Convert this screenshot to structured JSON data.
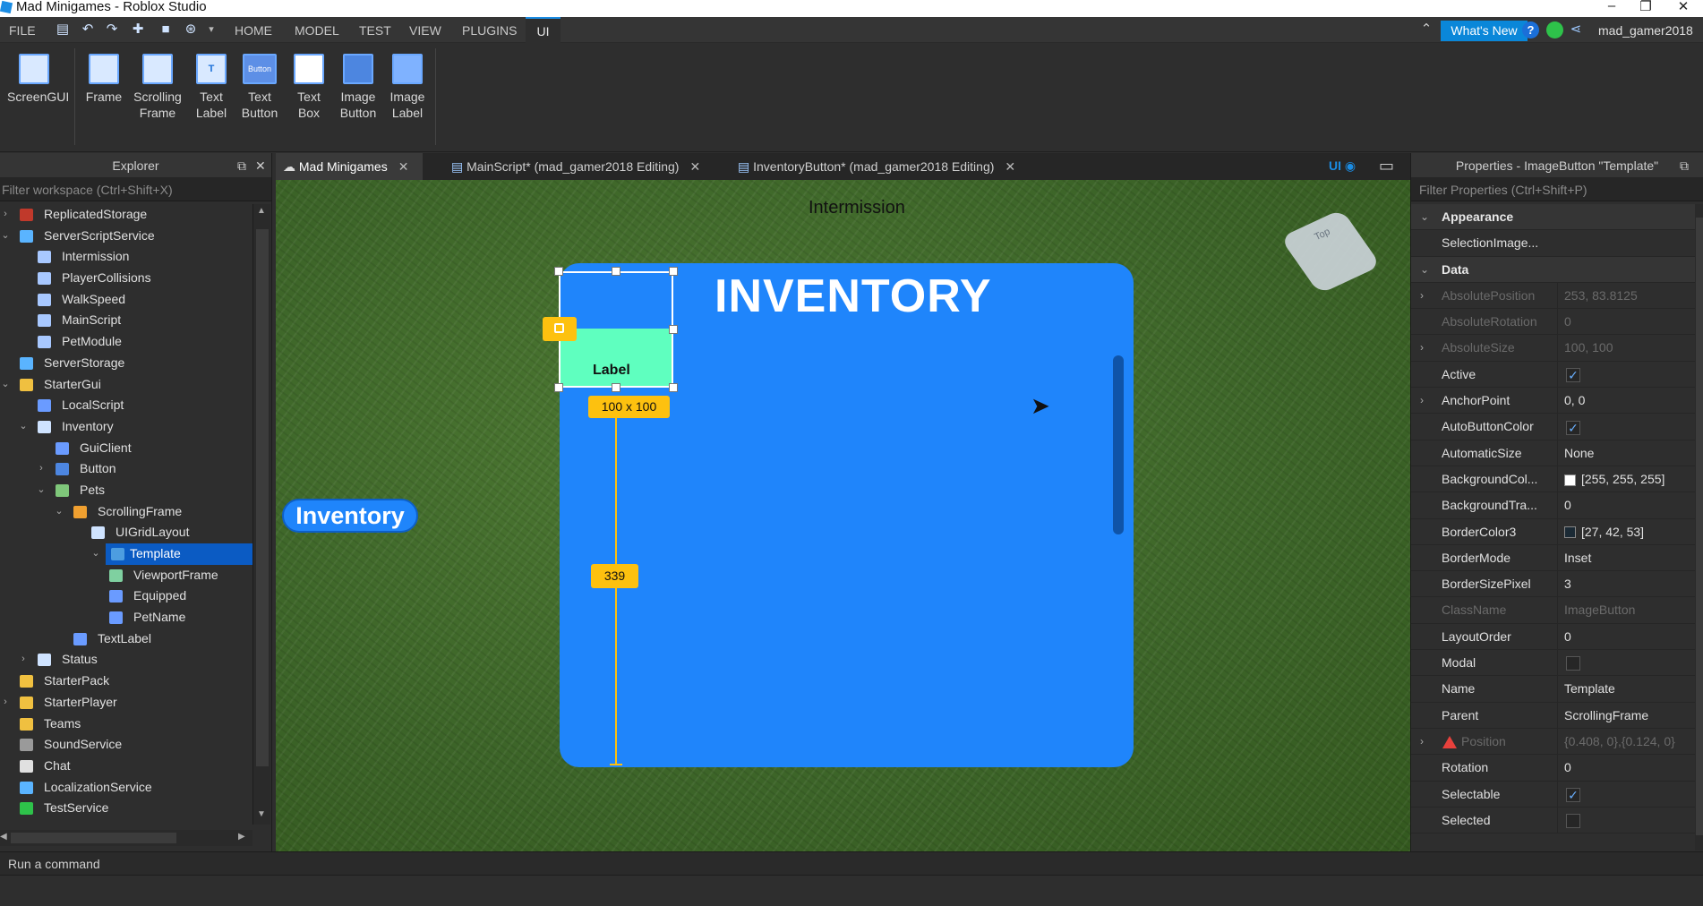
{
  "window": {
    "title": "Mad Minigames - Roblox Studio",
    "minimize": "–",
    "restore": "❐",
    "close": "✕"
  },
  "menu": {
    "file": "FILE",
    "home": "HOME",
    "model": "MODEL",
    "test": "TEST",
    "view": "VIEW",
    "plugins": "PLUGINS",
    "ui": "UI"
  },
  "header": {
    "whats_new": "What's New",
    "username": "mad_gamer2018"
  },
  "ribbon": {
    "screengui": "ScreenGUI",
    "frame": "Frame",
    "scrolling_frame_1": "Scrolling",
    "scrolling_frame_2": "Frame",
    "text_label_1": "Text",
    "text_label_2": "Label",
    "text_button_1": "Text",
    "text_button_2": "Button",
    "text_box_1": "Text",
    "text_box_2": "Box",
    "image_button_1": "Image",
    "image_button_2": "Button",
    "image_label_1": "Image",
    "image_label_2": "Label",
    "button_icon_text": "Button",
    "text_icon": "T"
  },
  "explorer": {
    "title": "Explorer",
    "filter_placeholder": "Filter workspace (Ctrl+Shift+X)",
    "items": [
      {
        "label": "ReplicatedStorage"
      },
      {
        "label": "ServerScriptService"
      },
      {
        "label": "Intermission"
      },
      {
        "label": "PlayerCollisions"
      },
      {
        "label": "WalkSpeed"
      },
      {
        "label": "MainScript"
      },
      {
        "label": "PetModule"
      },
      {
        "label": "ServerStorage"
      },
      {
        "label": "StarterGui"
      },
      {
        "label": "LocalScript"
      },
      {
        "label": "Inventory"
      },
      {
        "label": "GuiClient"
      },
      {
        "label": "Button"
      },
      {
        "label": "Pets"
      },
      {
        "label": "ScrollingFrame"
      },
      {
        "label": "UIGridLayout"
      },
      {
        "label": "Template"
      },
      {
        "label": "ViewportFrame"
      },
      {
        "label": "Equipped"
      },
      {
        "label": "PetName"
      },
      {
        "label": "TextLabel"
      },
      {
        "label": "Status"
      },
      {
        "label": "StarterPack"
      },
      {
        "label": "StarterPlayer"
      },
      {
        "label": "Teams"
      },
      {
        "label": "SoundService"
      },
      {
        "label": "Chat"
      },
      {
        "label": "LocalizationService"
      },
      {
        "label": "TestService"
      }
    ]
  },
  "tabs": [
    {
      "label": "Mad Minigames"
    },
    {
      "label": "MainScript* (mad_gamer2018 Editing)"
    },
    {
      "label": "InventoryButton* (mad_gamer2018 Editing)"
    }
  ],
  "viewport": {
    "ui_toggle": "UI",
    "intermission": "Intermission",
    "inventory_title": "INVENTORY",
    "template_label": "Label",
    "size_tag": "100 x 100",
    "distance_tag": "339",
    "inventory_button": "Inventory",
    "cube_label": "Top"
  },
  "properties": {
    "title": "Properties - ImageButton \"Template\"",
    "filter_placeholder": "Filter Properties (Ctrl+Shift+P)",
    "rows": [
      {
        "name": "Appearance",
        "value": ""
      },
      {
        "name": "SelectionImage...",
        "value": ""
      },
      {
        "name": "Data",
        "value": ""
      },
      {
        "name": "AbsolutePosition",
        "value": "253, 83.8125"
      },
      {
        "name": "AbsoluteRotation",
        "value": "0"
      },
      {
        "name": "AbsoluteSize",
        "value": "100, 100"
      },
      {
        "name": "Active",
        "value": ""
      },
      {
        "name": "AnchorPoint",
        "value": "0, 0"
      },
      {
        "name": "AutoButtonColor",
        "value": ""
      },
      {
        "name": "AutomaticSize",
        "value": "None"
      },
      {
        "name": "BackgroundCol...",
        "value": "[255, 255, 255]"
      },
      {
        "name": "BackgroundTra...",
        "value": "0"
      },
      {
        "name": "BorderColor3",
        "value": "[27, 42, 53]"
      },
      {
        "name": "BorderMode",
        "value": "Inset"
      },
      {
        "name": "BorderSizePixel",
        "value": "3"
      },
      {
        "name": "ClassName",
        "value": "ImageButton"
      },
      {
        "name": "LayoutOrder",
        "value": "0"
      },
      {
        "name": "Modal",
        "value": ""
      },
      {
        "name": "Name",
        "value": "Template"
      },
      {
        "name": "Parent",
        "value": "ScrollingFrame"
      },
      {
        "name": "Position",
        "value": "{0.408, 0},{0.124, 0}"
      },
      {
        "name": "Rotation",
        "value": "0"
      },
      {
        "name": "Selectable",
        "value": ""
      },
      {
        "name": "Selected",
        "value": ""
      }
    ]
  },
  "command_bar": {
    "placeholder": "Run a command"
  },
  "colors": {
    "accent": "#1b8ce3",
    "frame_blue": "#1f85fb",
    "template_green": "#5fffbf",
    "tag_yellow": "#fdc10f",
    "selection": "#0b5bc3"
  }
}
